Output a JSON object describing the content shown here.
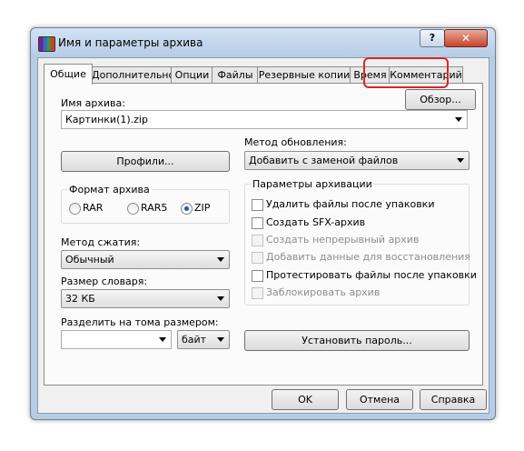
{
  "window": {
    "title": "Имя и параметры архива",
    "help_button": "?",
    "close_button": "✕",
    "app_icon": "winrar-books-icon"
  },
  "tabs": [
    "Общие",
    "Дополнительно",
    "Опции",
    "Файлы",
    "Резервные копии",
    "Время",
    "Комментарий"
  ],
  "archive_name": {
    "label": "Имя архива:",
    "value": "Картинки(1).zip",
    "browse_button": "Обзор..."
  },
  "profiles_button": "Профили...",
  "update_method": {
    "label": "Метод обновления:",
    "value": "Добавить с заменой файлов"
  },
  "archive_format": {
    "title": "Формат архива",
    "options": [
      "RAR",
      "RAR5",
      "ZIP"
    ],
    "selected": "ZIP"
  },
  "compression": {
    "label": "Метод сжатия:",
    "value": "Обычный"
  },
  "dictionary": {
    "label": "Размер словаря:",
    "value": "32 КБ"
  },
  "split": {
    "label": "Разделить на тома размером:",
    "value": "",
    "unit": "байт"
  },
  "archive_options": {
    "title": "Параметры архивации",
    "items": [
      {
        "label": "Удалить файлы после упаковки",
        "checked": false,
        "enabled": true
      },
      {
        "label": "Создать SFX-архив",
        "checked": false,
        "enabled": true
      },
      {
        "label": "Создать непрерывный архив",
        "checked": false,
        "enabled": false
      },
      {
        "label": "Добавить данные для восстановления",
        "checked": false,
        "enabled": false
      },
      {
        "label": "Протестировать файлы после упаковки",
        "checked": false,
        "enabled": true
      },
      {
        "label": "Заблокировать архив",
        "checked": false,
        "enabled": false
      }
    ]
  },
  "password_button": "Установить пароль...",
  "footer": {
    "ok": "OK",
    "cancel": "Отмена",
    "help": "Справка"
  },
  "colors": {
    "highlight": "#d9262a",
    "title_bar": "#b7cde6",
    "radio_dot": "#1f58b0"
  }
}
